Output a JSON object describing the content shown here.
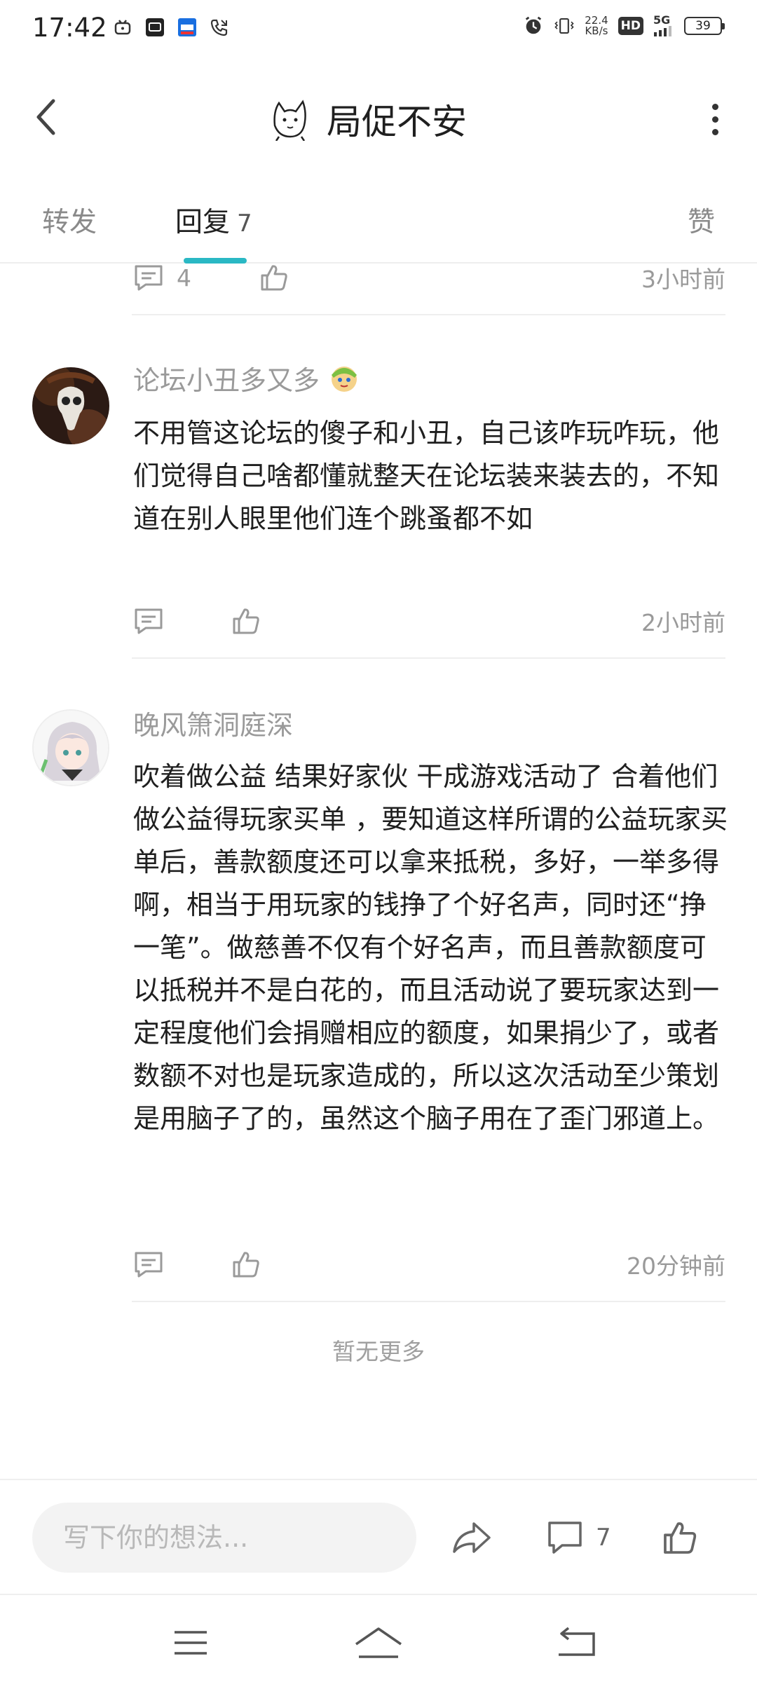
{
  "status_bar": {
    "time": "17:42",
    "net_speed_value": "22.4",
    "net_speed_unit": "KB/s",
    "hd": "HD",
    "network": "5G",
    "battery": "39"
  },
  "header": {
    "title": "局促不安"
  },
  "tabs": {
    "forward": "转发",
    "reply": "回复",
    "reply_count": "7",
    "like": "赞"
  },
  "comments": [
    {
      "comment_count": "4",
      "time": "3小时前"
    },
    {
      "username": "论坛小丑多又多",
      "text": "不用管这论坛的傻子和小丑，自己该咋玩咋玩，他们觉得自己啥都懂就整天在论坛装来装去的，不知道在别人眼里他们连个跳蚤都不如",
      "time": "2小时前"
    },
    {
      "username": "晚风箫洞庭深",
      "text": "吹着做公益  结果好家伙  干成游戏活动了  合着他们做公益得玩家买单 ，要知道这样所谓的公益玩家买单后，善款额度还可以拿来抵税，多好，一举多得啊，相当于用玩家的钱挣了个好名声，同时还“挣一笔”。做慈善不仅有个好名声，而且善款额度可以抵税并不是白花的，而且活动说了要玩家达到一定程度他们会捐赠相应的额度，如果捐少了，或者数额不对也是玩家造成的，所以这次活动至少策划是用脑子了的，虽然这个脑子用在了歪门邪道上。",
      "time": "20分钟前"
    }
  ],
  "no_more": "暂无更多",
  "bottom_bar": {
    "input_placeholder": "写下你的想法...",
    "comment_count": "7"
  },
  "colors": {
    "accent": "#2ab8c4",
    "muted_text": "#9a9a9a",
    "primary_text": "#1f1f1f"
  },
  "icons": [
    "back-arrow-icon",
    "more-vertical-icon",
    "comment-icon",
    "thumb-up-icon",
    "share-icon",
    "menu-icon",
    "home-icon",
    "return-icon"
  ]
}
